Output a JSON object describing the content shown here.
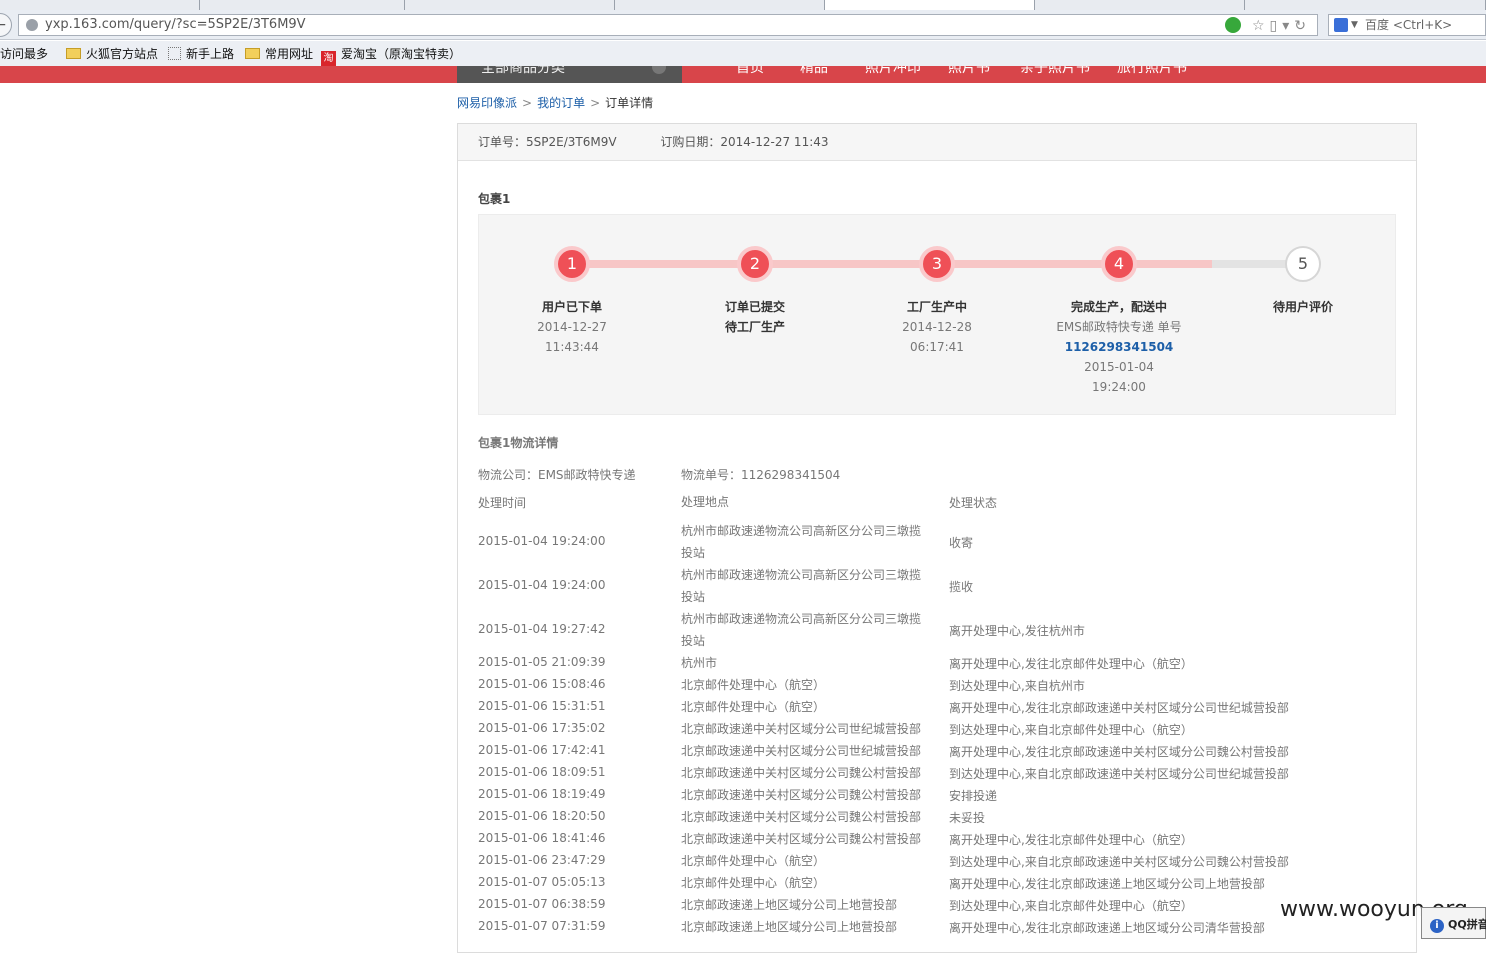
{
  "browser": {
    "url": "yxp.163.com/query/?sc=5SP2E/3T6M9V",
    "search_engine": "百度",
    "search_placeholder": "百度 <Ctrl+K>",
    "bookmarks": [
      "访问最多",
      "火狐官方站点",
      "新手上路",
      "常用网址",
      "爱淘宝（原淘宝特卖）"
    ]
  },
  "site_nav": {
    "category_label": "全部商品分类",
    "links": [
      "首页",
      "精品",
      "照片冲印",
      "照片书",
      "亲子照片书",
      "旅行照片书"
    ]
  },
  "breadcrumb": [
    "网易印像派",
    "我的订单",
    "订单详情"
  ],
  "order": {
    "number_label": "订单号：5SP2E/3T6M9V",
    "date_label": "订购日期：2014-12-27 11:43"
  },
  "package": {
    "title": "包裹1",
    "progress_fraction": 0.875,
    "steps": [
      {
        "num": "1",
        "title": "用户已下单",
        "title2": "",
        "lines": [
          "2014-12-27",
          "11:43:44"
        ],
        "link": "",
        "after": []
      },
      {
        "num": "2",
        "title": "订单已提交",
        "title2": "待工厂生产",
        "lines": [],
        "link": "",
        "after": []
      },
      {
        "num": "3",
        "title": "工厂生产中",
        "title2": "",
        "lines": [
          "2014-12-28",
          "06:17:41"
        ],
        "link": "",
        "after": []
      },
      {
        "num": "4",
        "title": "完成生产，配送中",
        "title2": "",
        "lines": [
          "EMS邮政特快专递 单号"
        ],
        "link": "1126298341504",
        "after": [
          "2015-01-04",
          "19:24:00"
        ]
      },
      {
        "num": "5",
        "title": "待用户评价",
        "title2": "",
        "lines": [],
        "link": "",
        "after": []
      }
    ]
  },
  "logistics": {
    "title": "包裹1物流详情",
    "company": "物流公司：EMS邮政特快专递",
    "tracking": "物流单号：1126298341504",
    "headers": [
      "处理时间",
      "处理地点",
      "处理状态"
    ],
    "rows": [
      [
        "2015-01-04 19:24:00",
        "杭州市邮政速递物流公司高新区分公司三墩揽投站",
        "收寄"
      ],
      [
        "2015-01-04 19:24:00",
        "杭州市邮政速递物流公司高新区分公司三墩揽投站",
        "揽收"
      ],
      [
        "2015-01-04 19:27:42",
        "杭州市邮政速递物流公司高新区分公司三墩揽投站",
        "离开处理中心,发往杭州市"
      ],
      [
        "2015-01-05 21:09:39",
        "杭州市",
        "离开处理中心,发往北京邮件处理中心（航空）"
      ],
      [
        "2015-01-06 15:08:46",
        "北京邮件处理中心（航空）",
        "到达处理中心,来自杭州市"
      ],
      [
        "2015-01-06 15:31:51",
        "北京邮件处理中心（航空）",
        "离开处理中心,发往北京邮政速递中关村区域分公司世纪城营投部"
      ],
      [
        "2015-01-06 17:35:02",
        "北京邮政速递中关村区域分公司世纪城营投部",
        "到达处理中心,来自北京邮件处理中心（航空）"
      ],
      [
        "2015-01-06 17:42:41",
        "北京邮政速递中关村区域分公司世纪城营投部",
        "离开处理中心,发往北京邮政速递中关村区域分公司魏公村营投部"
      ],
      [
        "2015-01-06 18:09:51",
        "北京邮政速递中关村区域分公司魏公村营投部",
        "到达处理中心,来自北京邮政速递中关村区域分公司世纪城营投部"
      ],
      [
        "2015-01-06 18:19:49",
        "北京邮政速递中关村区域分公司魏公村营投部",
        "安排投递"
      ],
      [
        "2015-01-06 18:20:50",
        "北京邮政速递中关村区域分公司魏公村营投部",
        "未妥投"
      ],
      [
        "2015-01-06 18:41:46",
        "北京邮政速递中关村区域分公司魏公村营投部",
        "离开处理中心,发往北京邮件处理中心（航空）"
      ],
      [
        "2015-01-06 23:47:29",
        "北京邮件处理中心（航空）",
        "到达处理中心,来自北京邮政速递中关村区域分公司魏公村营投部"
      ],
      [
        "2015-01-07 05:05:13",
        "北京邮件处理中心（航空）",
        "离开处理中心,发往北京邮政速递上地区域分公司上地营投部"
      ],
      [
        "2015-01-07 06:38:59",
        "北京邮政速递上地区域分公司上地营投部",
        "到达处理中心,来自北京邮件处理中心（航空）"
      ],
      [
        "2015-01-07 07:31:59",
        "北京邮政速递上地区域分公司上地营投部",
        "离开处理中心,发往北京邮政速递上地区域分公司清华营投部"
      ]
    ]
  },
  "watermark": "www.wooyun.org",
  "popup": "QQ拼音",
  "colors": {
    "accent_red": "#d8454a",
    "step_red": "#ef5057",
    "link_blue": "#1d5fa8"
  }
}
